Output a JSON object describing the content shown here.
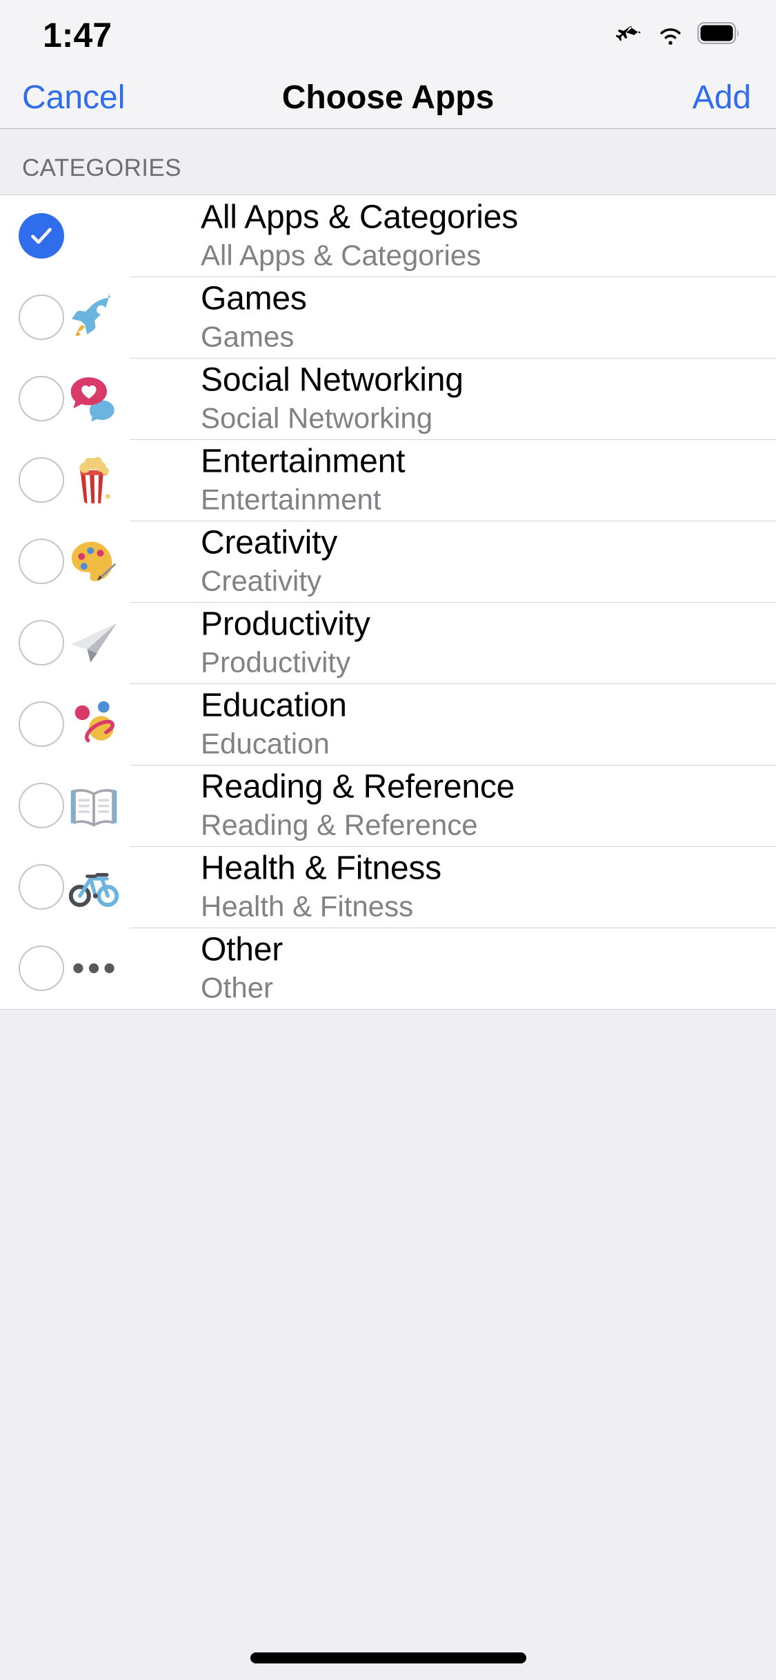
{
  "status_bar": {
    "time": "1:47",
    "icons": [
      "airplane-mode-icon",
      "wifi-icon",
      "battery-icon"
    ],
    "battery_full": true
  },
  "nav_bar": {
    "cancel_label": "Cancel",
    "title": "Choose Apps",
    "add_label": "Add",
    "accent_color": "#2f6dec"
  },
  "section": {
    "header": "CATEGORIES"
  },
  "rows": [
    {
      "title": "All Apps & Categories",
      "subtitle": "All Apps & Categories",
      "selected": true,
      "icon": "none"
    },
    {
      "title": "Games",
      "subtitle": "Games",
      "selected": false,
      "icon": "rocket-icon"
    },
    {
      "title": "Social Networking",
      "subtitle": "Social Networking",
      "selected": false,
      "icon": "chat-heart-icon"
    },
    {
      "title": "Entertainment",
      "subtitle": "Entertainment",
      "selected": false,
      "icon": "popcorn-icon"
    },
    {
      "title": "Creativity",
      "subtitle": "Creativity",
      "selected": false,
      "icon": "palette-icon"
    },
    {
      "title": "Productivity",
      "subtitle": "Productivity",
      "selected": false,
      "icon": "paper-plane-icon"
    },
    {
      "title": "Education",
      "subtitle": "Education",
      "selected": false,
      "icon": "planet-icon"
    },
    {
      "title": "Reading & Reference",
      "subtitle": "Reading & Reference",
      "selected": false,
      "icon": "open-book-icon"
    },
    {
      "title": "Health & Fitness",
      "subtitle": "Health & Fitness",
      "selected": false,
      "icon": "bicycle-icon"
    },
    {
      "title": "Other",
      "subtitle": "Other",
      "selected": false,
      "icon": "ellipsis-icon"
    }
  ],
  "colors": {
    "accent": "#2f6dec",
    "background": "#eeeef3",
    "list_background": "#ffffff",
    "separator": "#d4d4d8",
    "title_text": "#000000",
    "subtitle_text": "#818186",
    "header_text": "#6d6d72"
  }
}
